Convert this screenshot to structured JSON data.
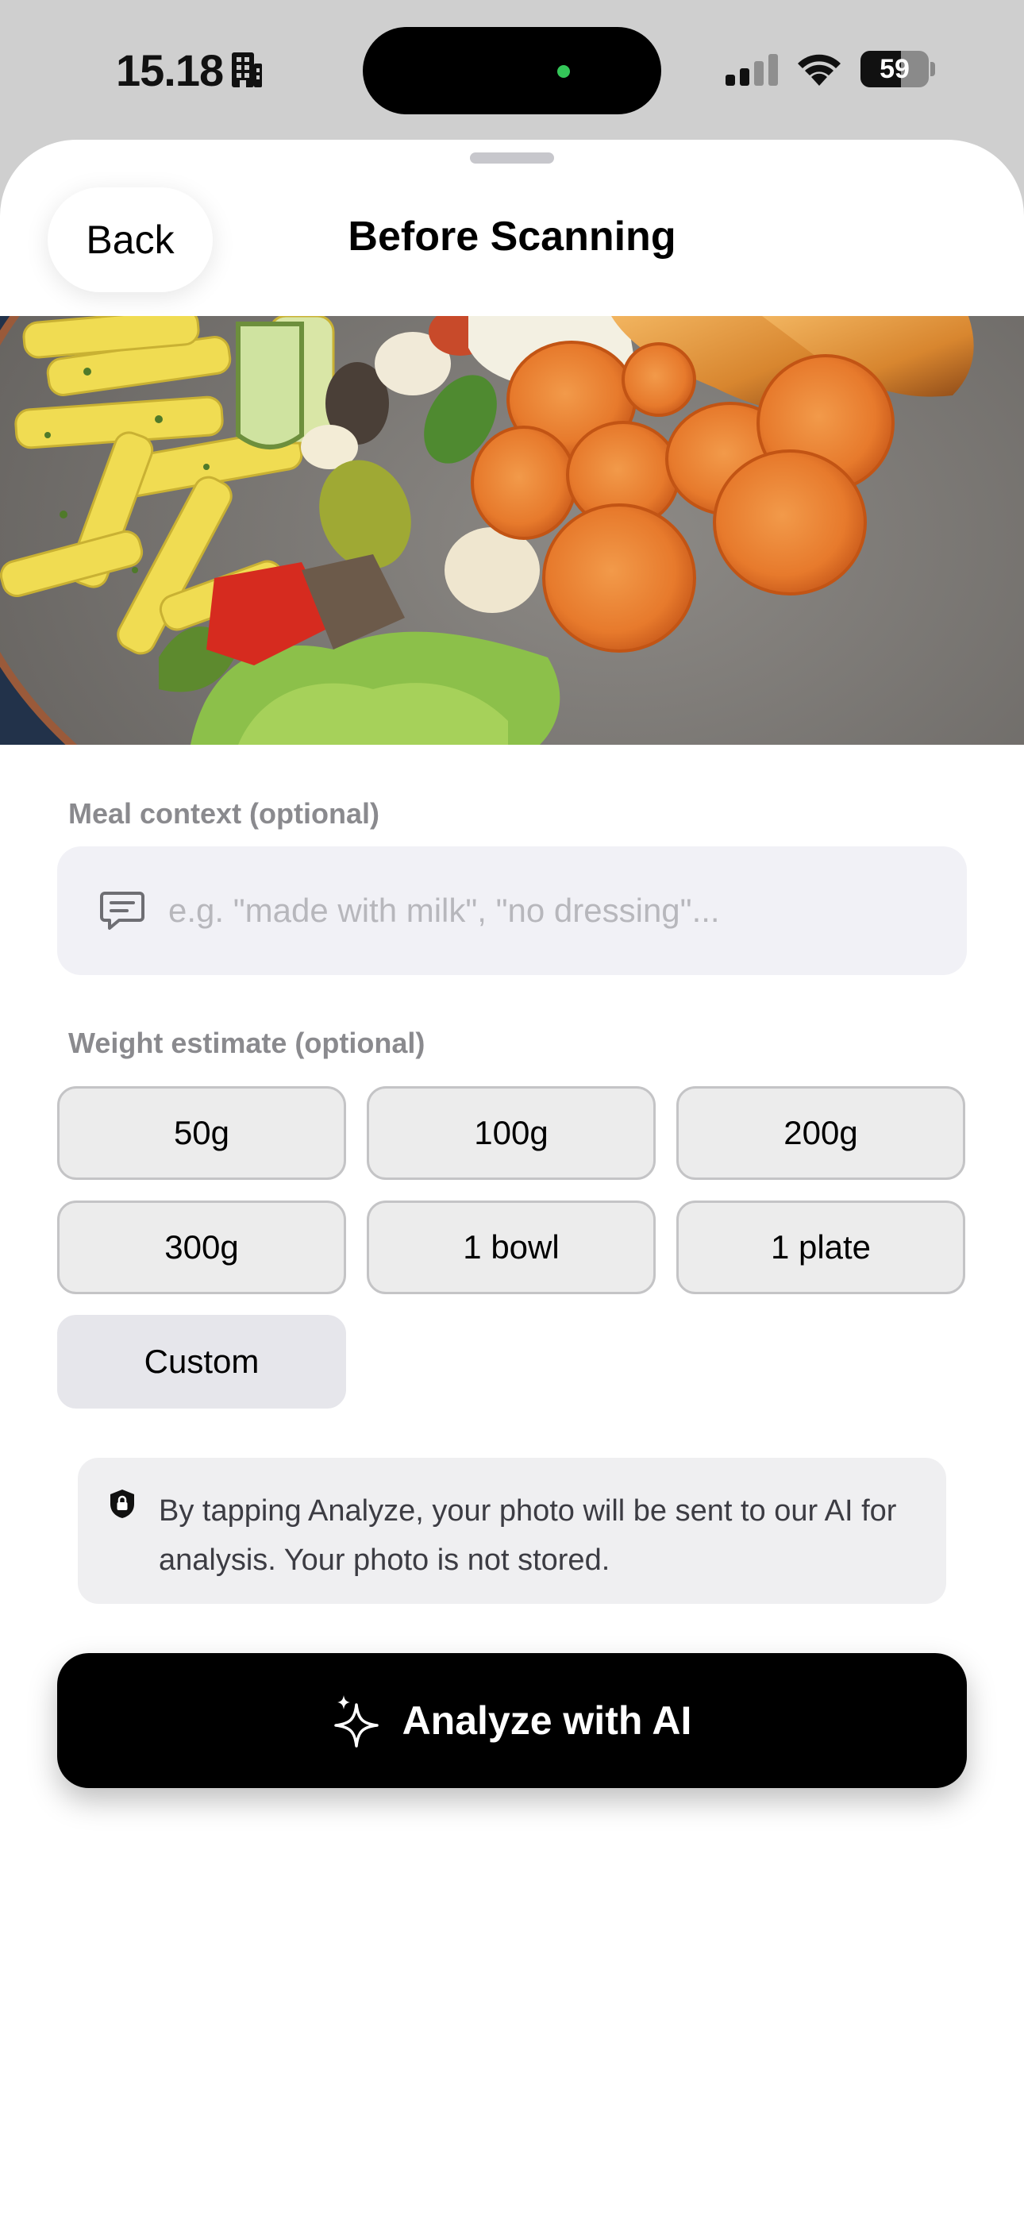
{
  "status_bar": {
    "time": "15.18",
    "battery_level": "59",
    "battery_percent": 59,
    "icons": [
      "building-icon",
      "signal-icon",
      "wifi-icon",
      "battery-icon"
    ]
  },
  "nav": {
    "back_label": "Back",
    "title": "Before Scanning"
  },
  "photo": {
    "description_icon": "food-photo"
  },
  "meal_context": {
    "label": "Meal context (optional)",
    "placeholder": "e.g. \"made with milk\", \"no dressing\"...",
    "value": "",
    "icon": "chat-bubble-icon"
  },
  "weight": {
    "label": "Weight estimate (optional)",
    "options": [
      "50g",
      "100g",
      "200g",
      "300g",
      "1 bowl",
      "1 plate",
      "Custom"
    ]
  },
  "privacy": {
    "icon": "lock-shield-icon",
    "text": "By tapping Analyze, your photo will be sent to our AI for analysis. Your photo is not stored."
  },
  "analyze": {
    "label": "Analyze with AI",
    "icon": "sparkle-icon"
  },
  "colors": {
    "accent": "#000000",
    "chip_bg": "#ececec",
    "field_bg": "#f1f1f6",
    "status_green": "#34c759"
  }
}
